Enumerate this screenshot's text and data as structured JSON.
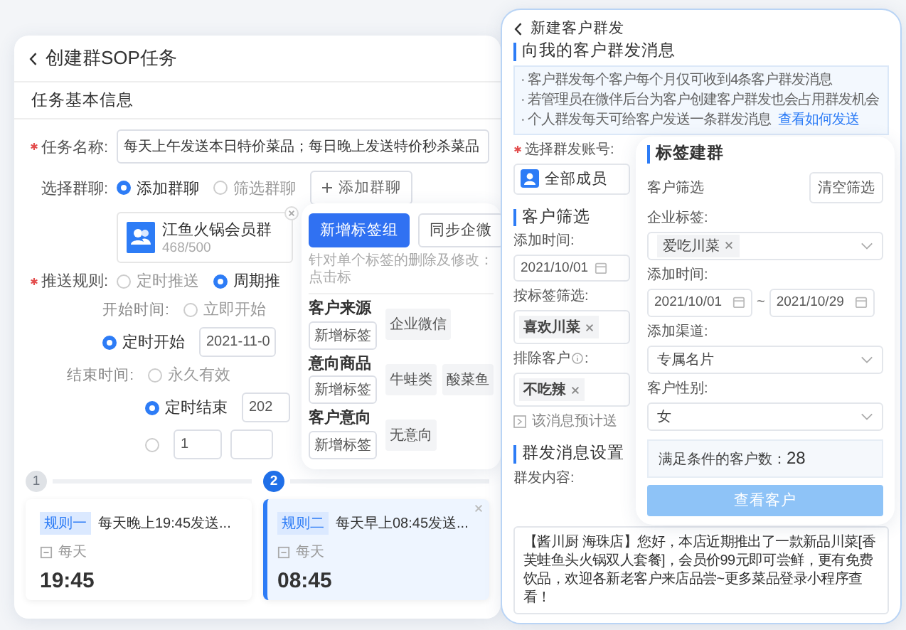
{
  "task_panel": {
    "title": "创建群SOP任务",
    "section": "任务基本信息",
    "name_field": {
      "label": "任务名称:",
      "required": true,
      "value": "每天上午发送本日特价菜品；每日晚上发送特价秒杀菜品"
    },
    "group_select": {
      "label": "选择群聊:",
      "required": false,
      "options": [
        {
          "label": "添加群聊",
          "selected": true
        },
        {
          "label": "筛选群聊",
          "selected": false
        }
      ],
      "add_button": "添加群聊"
    },
    "group_card": {
      "name": "江鱼火锅会员群",
      "count": "468/500"
    },
    "push_rule": {
      "label": "推送规则:",
      "required": true,
      "options": [
        {
          "label": "定时推送",
          "selected": false
        },
        {
          "label": "周期推",
          "selected": true
        }
      ]
    },
    "start_time": {
      "label": "开始时间:",
      "options": [
        {
          "kind": "plain",
          "label": "立即开始",
          "selected": false
        },
        {
          "kind": "date",
          "label": "定时开始",
          "selected": true,
          "value": "2021-11-0"
        }
      ]
    },
    "end_time": {
      "label": "结束时间:",
      "options": [
        {
          "kind": "plain",
          "label": "永久有效",
          "selected": false
        },
        {
          "kind": "date",
          "label": "定时结束",
          "selected": true,
          "value": "202"
        },
        {
          "kind": "count",
          "selected": false,
          "value": "1"
        }
      ]
    },
    "steps": [
      {
        "number": "1",
        "selected": false
      },
      {
        "number": "2",
        "selected": true
      }
    ],
    "rules": [
      {
        "tag": "规则一",
        "title": "每天晚上19:45发送...",
        "repeat": "每天",
        "time": "19:45",
        "selected": false
      },
      {
        "tag": "规则二",
        "title": "每天早上08:45发送...",
        "repeat": "每天",
        "time": "08:45",
        "selected": true
      }
    ]
  },
  "tag_panel": {
    "buttons": [
      {
        "label": "新增标签组",
        "kind": "primary"
      },
      {
        "label": "同步企微",
        "kind": "default"
      }
    ],
    "hint": "针对单个标签的删除及修改：点击标",
    "groups": [
      {
        "name": "客户来源",
        "add_button": "新增标签",
        "tags": [
          "企业微信"
        ]
      },
      {
        "name": "意向商品",
        "add_button": "新增标签",
        "tags": [
          "牛蛙类",
          "酸菜鱼"
        ]
      },
      {
        "name": "客户意向",
        "add_button": "新增标签",
        "tags": [
          "无意向"
        ]
      }
    ]
  },
  "broadcast_panel": {
    "title": "新建客户群发",
    "section": "向我的客户群发消息",
    "notices": [
      "· 客户群发每个客户每个月仅可收到4条客户群发消息",
      "· 若管理员在微伴后台为客户创建客户群发也会占用群发机会",
      "· 个人群发每天可给客户发送一条群发消息"
    ],
    "notice_link": "查看如何发送",
    "account": {
      "label": "选择群发账号:",
      "required": true,
      "value": "全部成员"
    },
    "filter_section": "客户筛选",
    "add_time": {
      "label": "添加时间:",
      "value": "2021/10/01"
    },
    "tag_filter": {
      "label": "按标签筛选:",
      "tags": [
        "喜欢川菜"
      ]
    },
    "exclude": {
      "label": "排除客户",
      "label_suffix": ":",
      "tags": [
        "不吃辣"
      ]
    },
    "estimate": "该消息预计送",
    "message_section": "群发消息设置",
    "content_label": "群发内容:",
    "content": "【酱川厨 海珠店】您好，本店近期推出了一款新品川菜[香芙蛙鱼头火锅双人套餐]，会员价99元即可尝鲜，更有免费饮品，欢迎各新老客户来店品尝~更多菜品登录小程序查看！"
  },
  "label_panel": {
    "title": "标签建群",
    "filter_label": "客户筛选",
    "clear_button": "清空筛选",
    "fields": [
      {
        "kind": "tags",
        "label": "企业标签:",
        "tags": [
          "爱吃川菜"
        ]
      },
      {
        "kind": "date_range",
        "label": "添加时间:",
        "from": "2021/10/01",
        "separator": "~",
        "to": "2021/10/29"
      },
      {
        "kind": "select",
        "label": "添加渠道:",
        "value": "专属名片"
      },
      {
        "kind": "select",
        "label": "客户性别:",
        "value": "女"
      }
    ],
    "count_label": "满足条件的客户数：",
    "count": "28",
    "view_button": "查看客户",
    "view_disabled": true
  }
}
